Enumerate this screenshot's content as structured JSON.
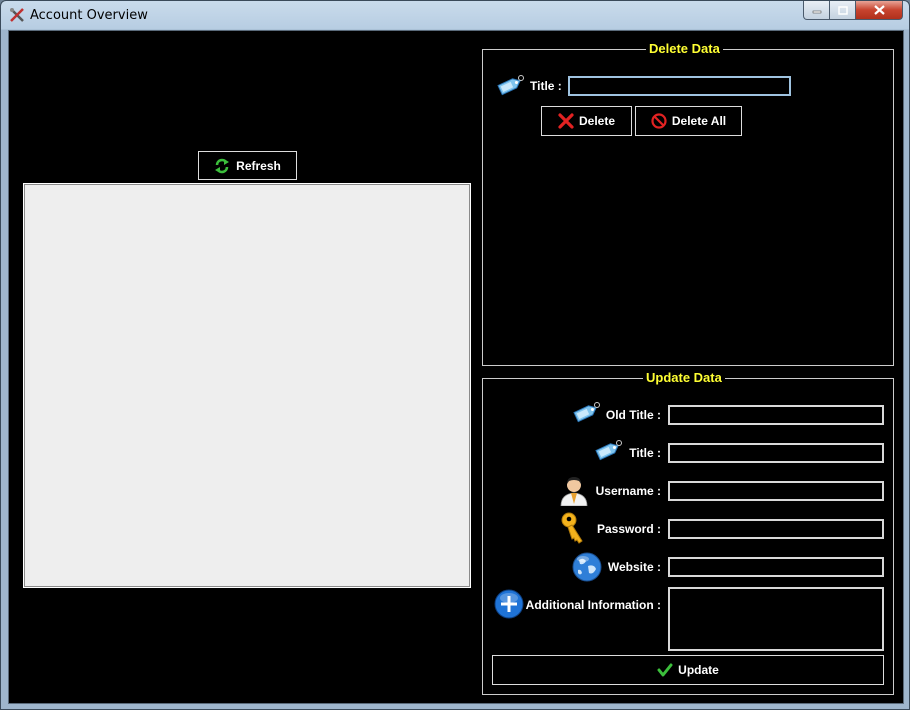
{
  "window": {
    "title": "Account Overview",
    "minimize_label": "–",
    "maximize_label": "□",
    "close_label": "✕"
  },
  "left": {
    "refresh_label": "Refresh"
  },
  "delete_data": {
    "group_title": "Delete Data",
    "title_label": "Title :",
    "title_value": "",
    "delete_label": "Delete",
    "delete_all_label": "Delete All"
  },
  "update_data": {
    "group_title": "Update Data",
    "old_title_label": "Old Title :",
    "old_title_value": "",
    "title_label": "Title :",
    "title_value": "",
    "username_label": "Username :",
    "username_value": "",
    "password_label": "Password :",
    "password_value": "",
    "website_label": "Website :",
    "website_value": "",
    "additional_label": "Additional Information :",
    "additional_value": "",
    "update_label": "Update"
  },
  "icons": {
    "app": "tools-icon",
    "refresh": "refresh-icon",
    "tag": "tag-icon",
    "delete": "red-x-icon",
    "delete_all": "no-entry-icon",
    "user": "user-icon",
    "password": "key-icon",
    "website": "globe-icon",
    "additional": "plus-circle-icon",
    "update": "checkmark-icon"
  },
  "colors": {
    "background": "#000000",
    "group_title": "#ffff33",
    "list_background": "#eeeeee",
    "text": "#ffffff"
  }
}
